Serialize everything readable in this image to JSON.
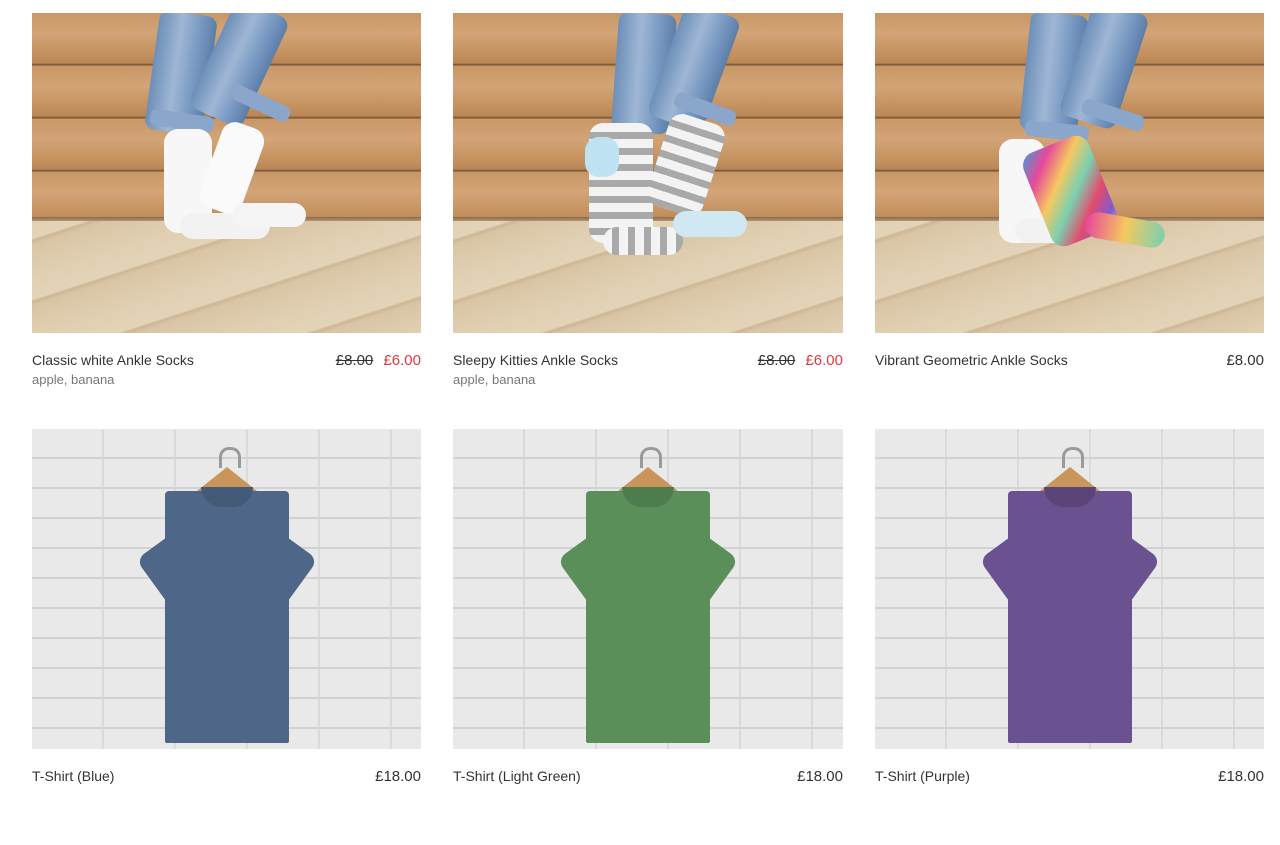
{
  "products": [
    {
      "name": "Classic white Ankle Socks",
      "tags": "apple, banana",
      "price": "£8.00",
      "sale_price": "£6.00",
      "image": "white-ankle-socks-photo",
      "sock_color": "#f7f7f7"
    },
    {
      "name": "Sleepy Kitties Ankle Socks",
      "tags": "apple, banana",
      "price": "£8.00",
      "sale_price": "£6.00",
      "image": "kitty-striped-socks-photo",
      "sock_color": "#cfe8f3"
    },
    {
      "name": "Vibrant Geometric Ankle Socks",
      "tags": "",
      "price": "£8.00",
      "sale_price": null,
      "image": "geometric-socks-photo",
      "sock_color": "#e9a0c0"
    },
    {
      "name": "T-Shirt (Blue)",
      "tags": "",
      "price": "£18.00",
      "sale_price": null,
      "image": "blue-tshirt-photo",
      "shirt_color": "#4e6688"
    },
    {
      "name": "T-Shirt (Light Green)",
      "tags": "",
      "price": "£18.00",
      "sale_price": null,
      "image": "green-tshirt-photo",
      "shirt_color": "#5a8f5a"
    },
    {
      "name": "T-Shirt (Purple)",
      "tags": "",
      "price": "£18.00",
      "sale_price": null,
      "image": "purple-tshirt-photo",
      "shirt_color": "#6a5290"
    }
  ],
  "colors": {
    "sale": "#e0393e",
    "text": "#333333",
    "muted": "#777777"
  }
}
